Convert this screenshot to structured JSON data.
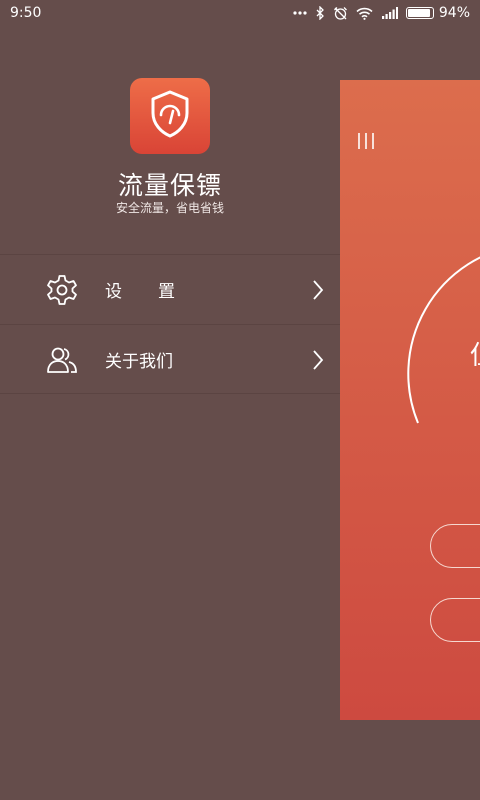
{
  "status_bar": {
    "time": "9:50",
    "battery": "94%",
    "battery_level": 0.94,
    "icons": [
      "more-dots-icon",
      "bluetooth-icon",
      "alarm-off-icon",
      "wifi-icon",
      "signal-icon",
      "battery-icon"
    ]
  },
  "drawer": {
    "app_name": "流量保镖",
    "app_tagline": "安全流量，省电省钱",
    "logo_icon": "shield-speedometer-icon",
    "items": [
      {
        "label": "设置",
        "icon": "gear-icon"
      },
      {
        "label": "关于我们",
        "icon": "users-icon"
      }
    ]
  },
  "main": {
    "menu_icon": "hamburger-icon",
    "gauge_text": "但"
  },
  "colors": {
    "drawer_bg": "#654d4b",
    "accent_top": "#dc6d4d",
    "accent_bottom": "#cd4a40"
  }
}
